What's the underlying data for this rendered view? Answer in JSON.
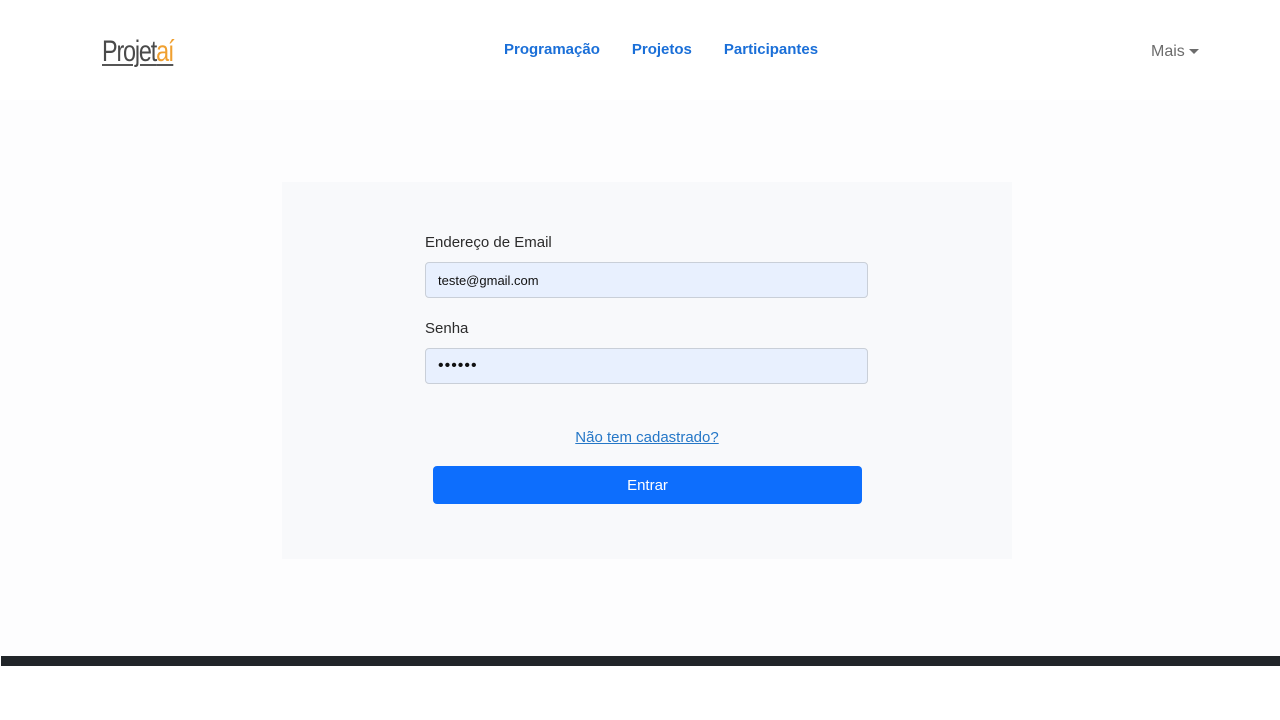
{
  "header": {
    "logo": {
      "main": "Projet",
      "accent": "aí"
    },
    "nav": [
      {
        "label": "Programação"
      },
      {
        "label": "Projetos"
      },
      {
        "label": "Participantes"
      }
    ],
    "more_label": "Mais"
  },
  "login_form": {
    "email_label": "Endereço de Email",
    "email_value": "teste@gmail.com",
    "password_label": "Senha",
    "password_value": "••••••",
    "register_link": "Não tem cadastrado?",
    "submit_label": "Entrar"
  },
  "colors": {
    "accent": "#0d6efd",
    "nav_link": "#1a6fd8",
    "logo_accent": "#f0a030",
    "footer": "#212529",
    "input_fill": "#e8f0fe"
  },
  "icons": {
    "more_menu": "caret-down-icon"
  }
}
